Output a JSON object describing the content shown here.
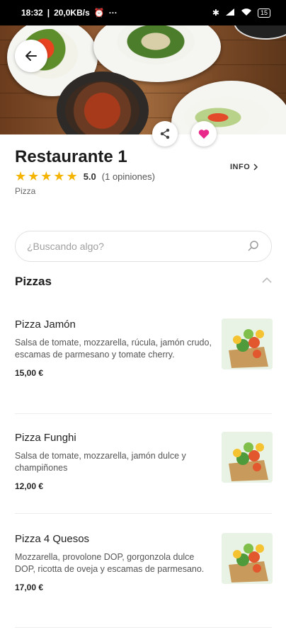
{
  "status_bar": {
    "time": "18:32",
    "speed": "20,0KB/s",
    "more": "···",
    "battery": "15"
  },
  "restaurant": {
    "name": "Restaurante 1",
    "rating": "5.0",
    "rating_value": 5,
    "opinions": "(1 opiniones)",
    "category": "Pizza",
    "info_label": "INFO"
  },
  "search": {
    "placeholder": "¿Buscando algo?"
  },
  "section": {
    "title": "Pizzas"
  },
  "items": [
    {
      "name": "Pizza Jamón",
      "description": "Salsa de tomate, mozzarella, rúcula, jamón crudo, escamas de parmesano y tomate cherry.",
      "price": "15,00 €"
    },
    {
      "name": "Pizza Funghi",
      "description": "Salsa de tomate, mozzarella, jamón dulce y champiñones",
      "price": "12,00 €"
    },
    {
      "name": "Pizza 4 Quesos",
      "description": "Mozzarella, provolone DOP, gorgonzola dulce DOP, ricotta de oveja y escamas de parmesano.",
      "price": "17,00 €"
    }
  ],
  "colors": {
    "favorite": "#e8288a",
    "star": "#f4b400"
  }
}
